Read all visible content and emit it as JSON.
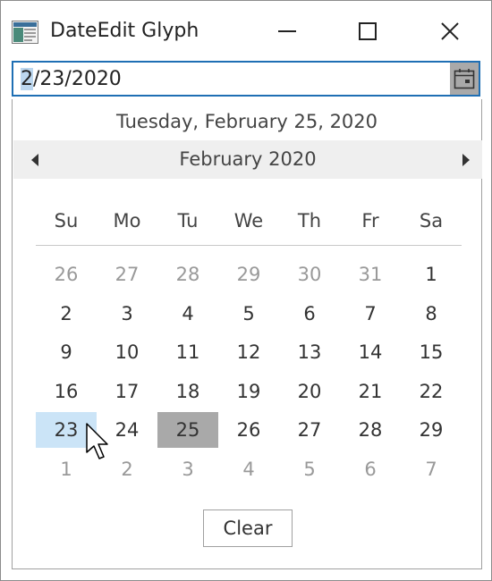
{
  "window": {
    "title": "DateEdit Glyph"
  },
  "date_edit": {
    "value_first": "2",
    "value_rest": "/23/2020"
  },
  "calendar": {
    "today_label": "Tuesday, February 25, 2020",
    "month_title": "February 2020",
    "weekdays": [
      "Su",
      "Mo",
      "Tu",
      "We",
      "Th",
      "Fr",
      "Sa"
    ],
    "weeks": [
      [
        "26",
        "27",
        "28",
        "29",
        "30",
        "31",
        "1"
      ],
      [
        "2",
        "3",
        "4",
        "5",
        "6",
        "7",
        "8"
      ],
      [
        "9",
        "10",
        "11",
        "12",
        "13",
        "14",
        "15"
      ],
      [
        "16",
        "17",
        "18",
        "19",
        "20",
        "21",
        "22"
      ],
      [
        "23",
        "24",
        "25",
        "26",
        "27",
        "28",
        "29"
      ],
      [
        "1",
        "2",
        "3",
        "4",
        "5",
        "6",
        "7"
      ]
    ],
    "selected_day": "23",
    "today_day": "25",
    "clear_label": "Clear"
  },
  "colors": {
    "accent": "#1f6fb4",
    "selected_bg": "#cbe4f7",
    "today_bg": "#a9a9a9",
    "nav_bg": "#efefef"
  },
  "icons": {
    "app": "app-window-icon",
    "minimize": "minimize-icon",
    "maximize": "maximize-icon",
    "close": "close-icon",
    "calendar": "calendar-icon",
    "prev": "triangle-left-icon",
    "next": "triangle-right-icon",
    "cursor": "mouse-pointer-icon"
  }
}
